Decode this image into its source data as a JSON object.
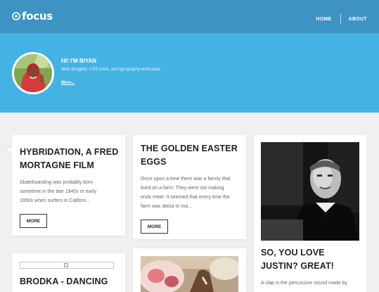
{
  "header": {
    "logo_text": "focus",
    "nav": {
      "home": "HOME",
      "about": "ABOUT"
    },
    "colors": {
      "bar": "#3d94c2",
      "hero": "#45b2e4"
    }
  },
  "hero": {
    "greeting": "HI! I'M BIYAN",
    "tagline": "Web designer, CSS Artist, and typography enthusiast",
    "more_link": "More..."
  },
  "posts": [
    {
      "title_lines": [
        "HYBRIDATION, A FRED",
        "MORTAGNE FILM"
      ],
      "excerpt_lines": [
        "Skateboarding was probably born",
        "sometime in the late 1940s or early",
        "1950s when surfers in Californ..."
      ],
      "button": "MORE"
    },
    {
      "title_lines": [
        "THE GOLDEN EASTER",
        "EGGS"
      ],
      "excerpt_lines": [
        "Once upon a time there was a family that",
        "lived on a farm. They were not making",
        "ends meet. It seemed that every time the",
        "farm was about to ma..."
      ],
      "button": "MORE"
    },
    {
      "image": "black-and-white-portrait",
      "title_lines": [
        "SO, YOU LOVE",
        "JUSTIN? GREAT!"
      ],
      "excerpt_lines": [
        "A clap is the percussive sound made by"
      ]
    },
    {
      "image": "broken-image-icon",
      "title_lines": [
        "BRODKA - DANCING"
      ]
    },
    {
      "image": "outdoor-photo"
    }
  ]
}
